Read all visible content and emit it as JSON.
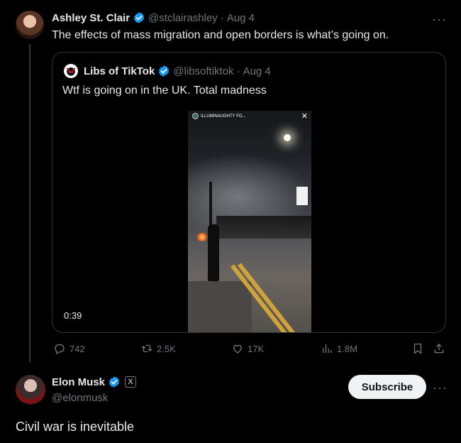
{
  "colors": {
    "verified": "#1d9bf0",
    "background": "#000000",
    "muted": "#71767b",
    "text": "#e7e9ea"
  },
  "post": {
    "author_name": "Ashley St. Clair",
    "handle": "@stclairashley",
    "separator": "·",
    "date": "Aug 4",
    "text": "The effects of mass migration and open borders is what’s going on.",
    "more": "···"
  },
  "quote": {
    "author_name": "Libs of TikTok",
    "handle": "@libsoftiktok",
    "separator": "·",
    "date": "Aug 4",
    "text": "Wtf is going on in the UK. Total madness",
    "media": {
      "overlay_caption": "ILLUMINAUGHTY FO...",
      "close": "✕",
      "duration": "0:39"
    }
  },
  "actions": {
    "replies": "742",
    "reposts": "2.5K",
    "likes": "17K",
    "views": "1.8M"
  },
  "reply": {
    "author_name": "Elon Musk",
    "affiliate_badge": "X",
    "handle": "@elonmusk",
    "subscribe_label": "Subscribe",
    "more": "···",
    "text": "Civil war is inevitable"
  }
}
